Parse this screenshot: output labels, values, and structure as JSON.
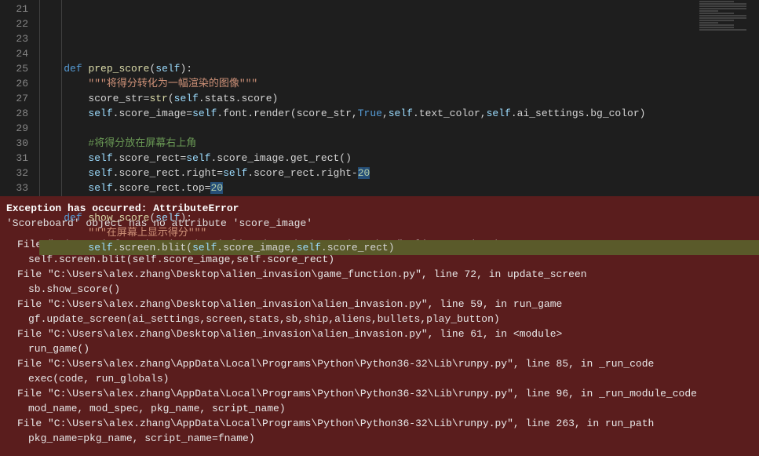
{
  "editor": {
    "lines": [
      {
        "num": "21",
        "tokens": [
          [
            "    ",
            ""
          ],
          [
            "def ",
            "kw"
          ],
          [
            "prep_score",
            "fn"
          ],
          [
            "(",
            ""
          ],
          [
            "self",
            "self"
          ],
          [
            "):",
            ""
          ]
        ]
      },
      {
        "num": "22",
        "tokens": [
          [
            "        ",
            ""
          ],
          [
            "\"\"\"将得分转化为一幅渲染的图像\"\"\"",
            "str"
          ]
        ]
      },
      {
        "num": "23",
        "tokens": [
          [
            "        score_str=",
            ""
          ],
          [
            "str",
            "fn"
          ],
          [
            "(",
            ""
          ],
          [
            "self",
            "self"
          ],
          [
            ".stats.score)",
            ""
          ]
        ]
      },
      {
        "num": "24",
        "tokens": [
          [
            "        ",
            ""
          ],
          [
            "self",
            "self"
          ],
          [
            ".score_image=",
            ""
          ],
          [
            "self",
            "self"
          ],
          [
            ".font.render(score_str,",
            ""
          ],
          [
            "True",
            "const"
          ],
          [
            ",",
            ""
          ],
          [
            "self",
            "self"
          ],
          [
            ".text_color,",
            ""
          ],
          [
            "self",
            "self"
          ],
          [
            ".ai_settings.bg_color)",
            ""
          ]
        ]
      },
      {
        "num": "25",
        "tokens": [
          [
            "",
            ""
          ]
        ]
      },
      {
        "num": "26",
        "tokens": [
          [
            "        ",
            ""
          ],
          [
            "#将得分放在屏幕右上角",
            "cmt"
          ]
        ]
      },
      {
        "num": "27",
        "tokens": [
          [
            "        ",
            ""
          ],
          [
            "self",
            "self"
          ],
          [
            ".score_rect=",
            ""
          ],
          [
            "self",
            "self"
          ],
          [
            ".score_image.get_rect()",
            ""
          ]
        ]
      },
      {
        "num": "28",
        "tokens": [
          [
            "        ",
            ""
          ],
          [
            "self",
            "self"
          ],
          [
            ".score_rect.right=",
            ""
          ],
          [
            "self",
            "self"
          ],
          [
            ".score_rect.right-",
            ""
          ],
          [
            "20",
            "num sel"
          ]
        ]
      },
      {
        "num": "29",
        "tokens": [
          [
            "        ",
            ""
          ],
          [
            "self",
            "self"
          ],
          [
            ".score_rect.top=",
            ""
          ],
          [
            "20",
            "num sel"
          ]
        ]
      },
      {
        "num": "30",
        "tokens": [
          [
            "",
            ""
          ]
        ]
      },
      {
        "num": "31",
        "tokens": [
          [
            "    ",
            ""
          ],
          [
            "def ",
            "kw"
          ],
          [
            "show_score",
            "fn"
          ],
          [
            "(",
            ""
          ],
          [
            "self",
            "self"
          ],
          [
            "):",
            ""
          ]
        ]
      },
      {
        "num": "32",
        "tokens": [
          [
            "        ",
            ""
          ],
          [
            "\"\"\"在屏幕上显示得分\"\"\"",
            "str"
          ]
        ]
      },
      {
        "num": "33",
        "highlight": true,
        "bp": true,
        "tokens": [
          [
            "        ",
            ""
          ],
          [
            "self",
            "self"
          ],
          [
            ".screen.blit(",
            ""
          ],
          [
            "self",
            "self"
          ],
          [
            ".score_image,",
            ""
          ],
          [
            "self",
            "self"
          ],
          [
            ".score_rect)",
            ""
          ]
        ]
      }
    ]
  },
  "exception": {
    "title": "Exception has occurred: AttributeError",
    "message": "'Scoreboard' object has no attribute 'score_image'",
    "frames": [
      {
        "loc": "File \"C:\\Users\\alex.zhang\\Desktop\\alien_invasion\\scoreboard.py\", line 33, in show_score",
        "src": "self.screen.blit(self.score_image,self.score_rect)"
      },
      {
        "loc": "File \"C:\\Users\\alex.zhang\\Desktop\\alien_invasion\\game_function.py\", line 72, in update_screen",
        "src": "sb.show_score()"
      },
      {
        "loc": "File \"C:\\Users\\alex.zhang\\Desktop\\alien_invasion\\alien_invasion.py\", line 59, in run_game",
        "src": "gf.update_screen(ai_settings,screen,stats,sb,ship,aliens,bullets,play_button)"
      },
      {
        "loc": "File \"C:\\Users\\alex.zhang\\Desktop\\alien_invasion\\alien_invasion.py\", line 61, in <module>",
        "src": "run_game()"
      },
      {
        "loc": "File \"C:\\Users\\alex.zhang\\AppData\\Local\\Programs\\Python\\Python36-32\\Lib\\runpy.py\", line 85, in _run_code",
        "src": "exec(code, run_globals)"
      },
      {
        "loc": "File \"C:\\Users\\alex.zhang\\AppData\\Local\\Programs\\Python\\Python36-32\\Lib\\runpy.py\", line 96, in _run_module_code",
        "src": "mod_name, mod_spec, pkg_name, script_name)"
      },
      {
        "loc": "File \"C:\\Users\\alex.zhang\\AppData\\Local\\Programs\\Python\\Python36-32\\Lib\\runpy.py\", line 263, in run_path",
        "src": "pkg_name=pkg_name, script_name=fname)"
      }
    ]
  }
}
